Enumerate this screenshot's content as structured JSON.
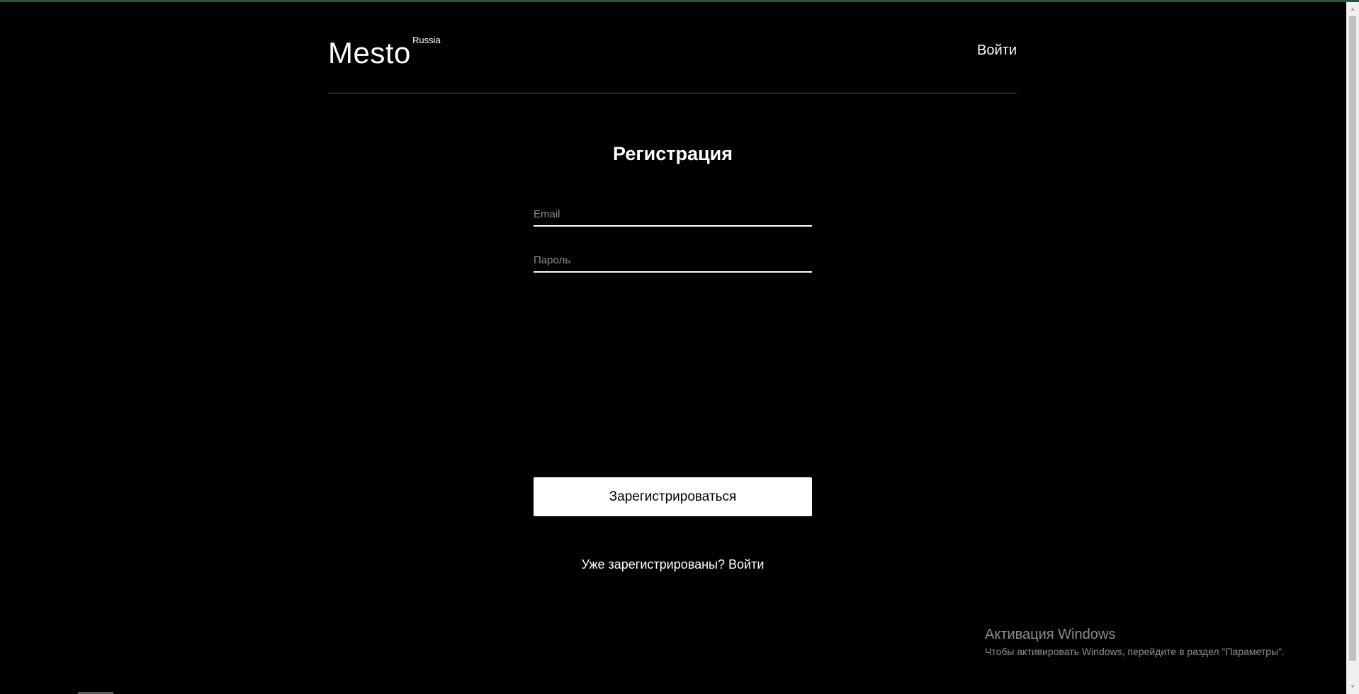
{
  "header": {
    "logo_text": "Mesto",
    "logo_superscript": "Russia",
    "login_link": "Войти"
  },
  "form": {
    "title": "Регистрация",
    "email": {
      "value": "",
      "placeholder": "Email"
    },
    "password": {
      "value": "",
      "placeholder": "Пароль"
    },
    "submit_label": "Зарегистрироваться"
  },
  "footer": {
    "already_registered_text": "Уже зарегистрированы?",
    "login_link": "Войти"
  },
  "windows_watermark": {
    "title": "Активация Windows",
    "subtitle": "Чтобы активировать Windows, перейдите в раздел \"Параметры\"."
  },
  "colors": {
    "background": "#000000",
    "text": "#ffffff",
    "divider": "#545454",
    "placeholder": "#8a8a8a",
    "button_bg": "#ffffff",
    "button_text": "#000000",
    "watermark": "#8c8c8c"
  },
  "icons": {
    "scroll_up": "scroll-up-arrow-icon",
    "scroll_down": "scroll-down-arrow-icon"
  }
}
